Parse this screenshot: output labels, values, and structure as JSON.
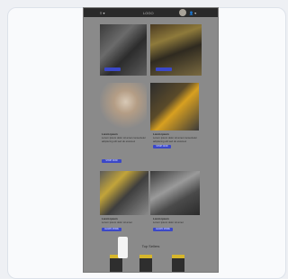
{
  "topbar": {
    "left": "≡ ▾",
    "center": "LOGO",
    "right": "👤 ▾"
  },
  "sections": [
    {
      "caption_title": "Lorem ipsum",
      "caption_lines": [
        "Lorem ipsum dolor sit amet consectetur",
        "adipiscing elit sed do eiusmod"
      ],
      "button": "SHOP NOW"
    },
    {
      "caption_title": "Lorem ipsum",
      "caption_lines": [
        "Lorem ipsum dolor sit amet consectetur",
        "adipiscing elit sed do eiusmod"
      ],
      "button": "SHOP NOW"
    },
    {
      "caption_title": "Lorem ipsum",
      "caption_lines": [
        "Lorem ipsum dolor sit amet",
        "consectetur adipiscing elit sed"
      ],
      "button": "LEARN MORE"
    },
    {
      "caption_title": "Lorem ipsum",
      "caption_lines": [
        "Lorem ipsum dolor sit amet",
        "consectetur adipiscing elit"
      ],
      "button": "LEARN MORE"
    }
  ],
  "products_heading": "Top Sellers"
}
